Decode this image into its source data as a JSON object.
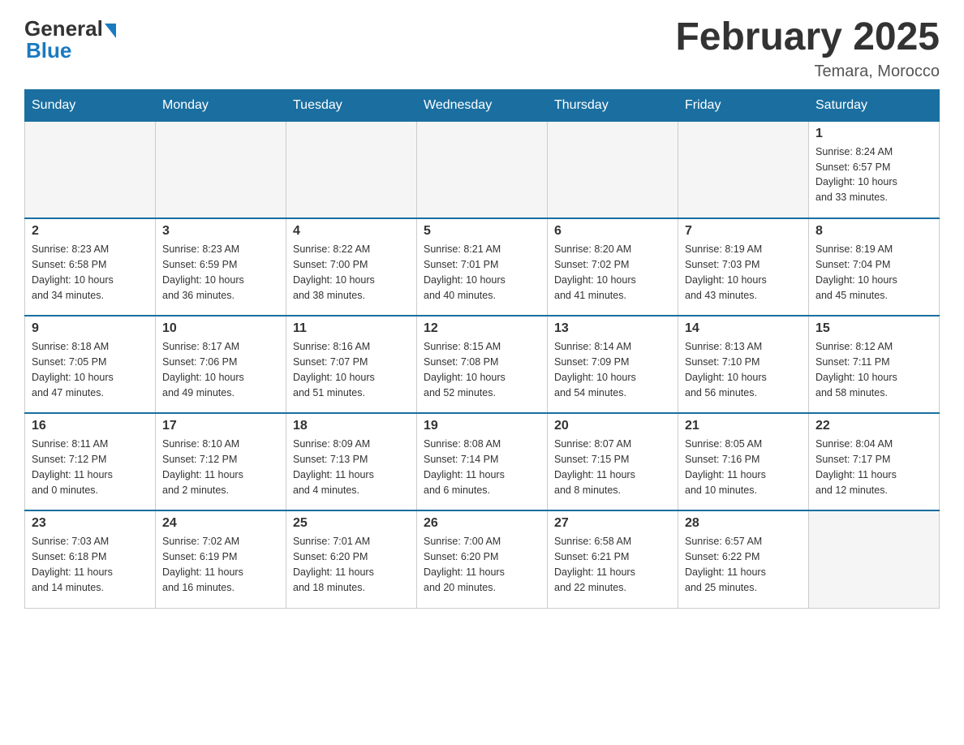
{
  "header": {
    "logo_general": "General",
    "logo_blue": "Blue",
    "month_title": "February 2025",
    "location": "Temara, Morocco"
  },
  "days_of_week": [
    "Sunday",
    "Monday",
    "Tuesday",
    "Wednesday",
    "Thursday",
    "Friday",
    "Saturday"
  ],
  "weeks": [
    [
      {
        "day": "",
        "info": ""
      },
      {
        "day": "",
        "info": ""
      },
      {
        "day": "",
        "info": ""
      },
      {
        "day": "",
        "info": ""
      },
      {
        "day": "",
        "info": ""
      },
      {
        "day": "",
        "info": ""
      },
      {
        "day": "1",
        "info": "Sunrise: 8:24 AM\nSunset: 6:57 PM\nDaylight: 10 hours\nand 33 minutes."
      }
    ],
    [
      {
        "day": "2",
        "info": "Sunrise: 8:23 AM\nSunset: 6:58 PM\nDaylight: 10 hours\nand 34 minutes."
      },
      {
        "day": "3",
        "info": "Sunrise: 8:23 AM\nSunset: 6:59 PM\nDaylight: 10 hours\nand 36 minutes."
      },
      {
        "day": "4",
        "info": "Sunrise: 8:22 AM\nSunset: 7:00 PM\nDaylight: 10 hours\nand 38 minutes."
      },
      {
        "day": "5",
        "info": "Sunrise: 8:21 AM\nSunset: 7:01 PM\nDaylight: 10 hours\nand 40 minutes."
      },
      {
        "day": "6",
        "info": "Sunrise: 8:20 AM\nSunset: 7:02 PM\nDaylight: 10 hours\nand 41 minutes."
      },
      {
        "day": "7",
        "info": "Sunrise: 8:19 AM\nSunset: 7:03 PM\nDaylight: 10 hours\nand 43 minutes."
      },
      {
        "day": "8",
        "info": "Sunrise: 8:19 AM\nSunset: 7:04 PM\nDaylight: 10 hours\nand 45 minutes."
      }
    ],
    [
      {
        "day": "9",
        "info": "Sunrise: 8:18 AM\nSunset: 7:05 PM\nDaylight: 10 hours\nand 47 minutes."
      },
      {
        "day": "10",
        "info": "Sunrise: 8:17 AM\nSunset: 7:06 PM\nDaylight: 10 hours\nand 49 minutes."
      },
      {
        "day": "11",
        "info": "Sunrise: 8:16 AM\nSunset: 7:07 PM\nDaylight: 10 hours\nand 51 minutes."
      },
      {
        "day": "12",
        "info": "Sunrise: 8:15 AM\nSunset: 7:08 PM\nDaylight: 10 hours\nand 52 minutes."
      },
      {
        "day": "13",
        "info": "Sunrise: 8:14 AM\nSunset: 7:09 PM\nDaylight: 10 hours\nand 54 minutes."
      },
      {
        "day": "14",
        "info": "Sunrise: 8:13 AM\nSunset: 7:10 PM\nDaylight: 10 hours\nand 56 minutes."
      },
      {
        "day": "15",
        "info": "Sunrise: 8:12 AM\nSunset: 7:11 PM\nDaylight: 10 hours\nand 58 minutes."
      }
    ],
    [
      {
        "day": "16",
        "info": "Sunrise: 8:11 AM\nSunset: 7:12 PM\nDaylight: 11 hours\nand 0 minutes."
      },
      {
        "day": "17",
        "info": "Sunrise: 8:10 AM\nSunset: 7:12 PM\nDaylight: 11 hours\nand 2 minutes."
      },
      {
        "day": "18",
        "info": "Sunrise: 8:09 AM\nSunset: 7:13 PM\nDaylight: 11 hours\nand 4 minutes."
      },
      {
        "day": "19",
        "info": "Sunrise: 8:08 AM\nSunset: 7:14 PM\nDaylight: 11 hours\nand 6 minutes."
      },
      {
        "day": "20",
        "info": "Sunrise: 8:07 AM\nSunset: 7:15 PM\nDaylight: 11 hours\nand 8 minutes."
      },
      {
        "day": "21",
        "info": "Sunrise: 8:05 AM\nSunset: 7:16 PM\nDaylight: 11 hours\nand 10 minutes."
      },
      {
        "day": "22",
        "info": "Sunrise: 8:04 AM\nSunset: 7:17 PM\nDaylight: 11 hours\nand 12 minutes."
      }
    ],
    [
      {
        "day": "23",
        "info": "Sunrise: 7:03 AM\nSunset: 6:18 PM\nDaylight: 11 hours\nand 14 minutes."
      },
      {
        "day": "24",
        "info": "Sunrise: 7:02 AM\nSunset: 6:19 PM\nDaylight: 11 hours\nand 16 minutes."
      },
      {
        "day": "25",
        "info": "Sunrise: 7:01 AM\nSunset: 6:20 PM\nDaylight: 11 hours\nand 18 minutes."
      },
      {
        "day": "26",
        "info": "Sunrise: 7:00 AM\nSunset: 6:20 PM\nDaylight: 11 hours\nand 20 minutes."
      },
      {
        "day": "27",
        "info": "Sunrise: 6:58 AM\nSunset: 6:21 PM\nDaylight: 11 hours\nand 22 minutes."
      },
      {
        "day": "28",
        "info": "Sunrise: 6:57 AM\nSunset: 6:22 PM\nDaylight: 11 hours\nand 25 minutes."
      },
      {
        "day": "",
        "info": ""
      }
    ]
  ]
}
